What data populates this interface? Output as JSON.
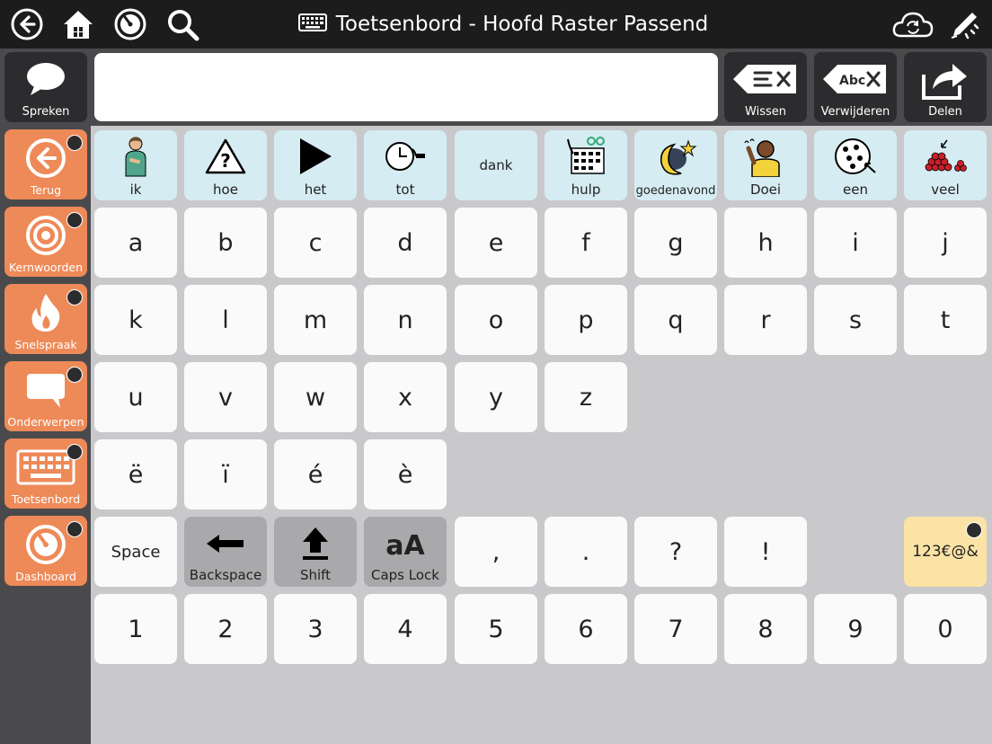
{
  "topbar": {
    "title": "Toetsenbord - Hoofd Raster Passend",
    "icons": [
      "back-icon",
      "home-icon",
      "dashboard-icon",
      "search-icon",
      "keyboard-icon",
      "sync-icon",
      "edit-icon"
    ]
  },
  "message_row": {
    "speak_label": "Spreken",
    "message_text": "",
    "wissen_label": "Wissen",
    "verwijderen_label": "Verwijderen",
    "delen_label": "Delen"
  },
  "sidebar": {
    "items": [
      {
        "label": "Terug"
      },
      {
        "label": "Kernwoorden"
      },
      {
        "label": "Snelspraak"
      },
      {
        "label": "Onderwerpen"
      },
      {
        "label": "Toetsenbord"
      },
      {
        "label": "Dashboard"
      }
    ]
  },
  "words": [
    "ik",
    "hoe",
    "het",
    "tot",
    "dank",
    "hulp",
    "goedenavond",
    "Doei",
    "een",
    "veel"
  ],
  "letters": {
    "row1": [
      "a",
      "b",
      "c",
      "d",
      "e",
      "f",
      "g",
      "h",
      "i",
      "j"
    ],
    "row2": [
      "k",
      "l",
      "m",
      "n",
      "o",
      "p",
      "q",
      "r",
      "s",
      "t"
    ],
    "row3": [
      "u",
      "v",
      "w",
      "x",
      "y",
      "z"
    ],
    "row4": [
      "ë",
      "ï",
      "é",
      "è"
    ]
  },
  "specials": {
    "space": "Space",
    "backspace": "Backspace",
    "shift": "Shift",
    "capslock": "Caps Lock",
    "capslock_glyph": "aA",
    "punct": [
      ",",
      ".",
      "?",
      "!"
    ],
    "symbols": "123€@&"
  },
  "digits": [
    "1",
    "2",
    "3",
    "4",
    "5",
    "6",
    "7",
    "8",
    "9",
    "0"
  ],
  "colors": {
    "topbar": "#1c1c1c",
    "sidebar": "#4a4a4c",
    "orange": "#ed8a58",
    "word_cell": "#d5ecf2",
    "grid_bg": "#c9c9cc",
    "symbols_cell": "#fbe3a6"
  }
}
